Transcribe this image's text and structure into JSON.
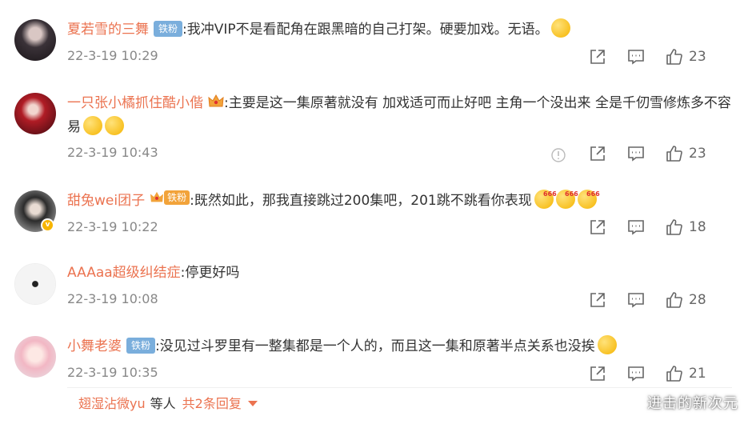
{
  "comments": [
    {
      "username": "夏若雪的三舞",
      "badge_fan": "铁粉",
      "text": ":我冲VIP不是看配角在跟黑暗的自己打架。硬要加戏。无语。",
      "time": "22-3-19 10:29",
      "likes": "23"
    },
    {
      "username": "一只张小橘抓住酷小偕",
      "text": ":主要是这一集原著就没有 加戏适可而止好吧 主角一个没出来 全是千仞雪修炼多不容易",
      "time": "22-3-19 10:43",
      "likes": "23"
    },
    {
      "username": "甜兔wei团子",
      "badge_fan": "铁粉",
      "text": ":既然如此，那我直接跳过200集吧，201跳不跳看你表现",
      "time": "22-3-19 10:22",
      "likes": "18"
    },
    {
      "username": "AAAaa超级纠结症",
      "text": ":停更好吗",
      "time": "22-3-19 10:08",
      "likes": "28"
    },
    {
      "username": "小舞老婆",
      "badge_fan": "铁粉",
      "text": ":没见过斗罗里有一整集都是一个人的，而且这一集和原著半点关系也没挨",
      "time": "22-3-19 10:35",
      "likes": "21"
    }
  ],
  "reply_summary": {
    "who": "翅湿沾微yu",
    "etc": "等人",
    "total": "共2条回复"
  },
  "watermark": "进击的新次元",
  "colors": {
    "username": "#eb7350",
    "time": "#888888",
    "fan_badge": "#7aaedc",
    "text": "#333333"
  }
}
